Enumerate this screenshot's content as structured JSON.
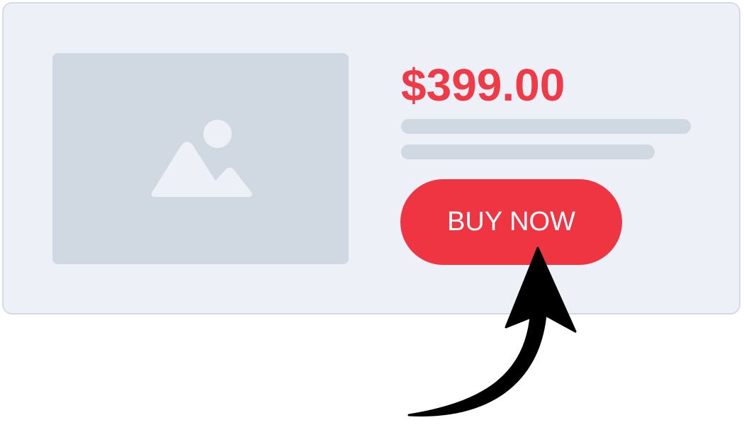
{
  "product": {
    "price": "$399.00",
    "image_icon": "image-placeholder-icon",
    "description_lines": 2
  },
  "actions": {
    "buy_label": "BUY NOW"
  },
  "annotation": {
    "icon": "curved-arrow-icon"
  },
  "colors": {
    "accent": "#f03a47",
    "button": "#f03542",
    "card_bg": "#edf1f7",
    "placeholder": "#d0d8e2",
    "arrow": "#000000"
  }
}
